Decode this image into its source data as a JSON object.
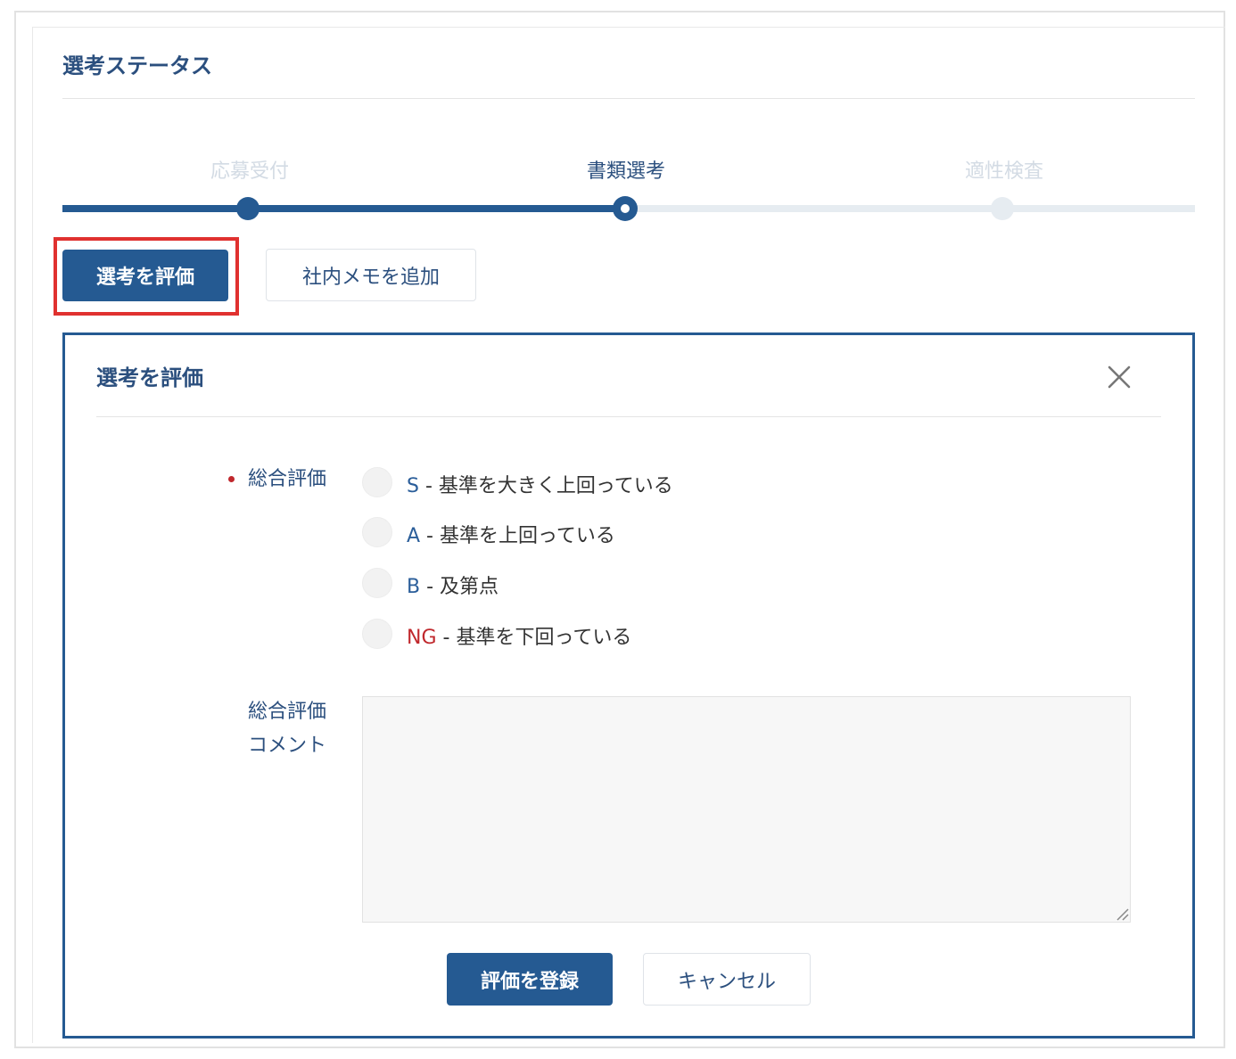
{
  "section": {
    "title": "選考ステータス"
  },
  "stepper": {
    "steps": [
      {
        "label": "応募受付",
        "state": "done"
      },
      {
        "label": "書類選考",
        "state": "current"
      },
      {
        "label": "適性検査",
        "state": "future"
      }
    ]
  },
  "actions": {
    "evaluate_label": "選考を評価",
    "memo_label": "社内メモを追加"
  },
  "dialog": {
    "title": "選考を評価",
    "overall_label": "総合評価",
    "options": [
      {
        "grade": "S",
        "desc": " - 基準を大きく上回っている"
      },
      {
        "grade": "A",
        "desc": " - 基準を上回っている"
      },
      {
        "grade": "B",
        "desc": " - 及第点"
      },
      {
        "grade": "NG",
        "desc": " - 基準を下回っている"
      }
    ],
    "comment_label_line1": "総合評価",
    "comment_label_line2": "コメント",
    "comment_value": "",
    "submit_label": "評価を登録",
    "cancel_label": "キャンセル"
  },
  "colors": {
    "primary": "#255a92",
    "title": "#2b4f7e",
    "required": "#c0282d",
    "highlight": "#e0312f"
  }
}
